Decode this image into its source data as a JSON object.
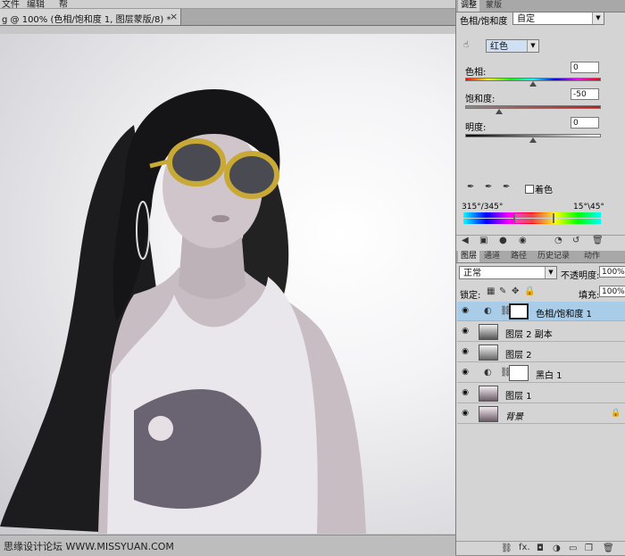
{
  "menu": {
    "items": [
      "文件",
      "编辑",
      "帮"
    ]
  },
  "document": {
    "tab_label": "g @ 100% (色相/饱和度 1, 图层蒙版/8) *",
    "close_glyph": "×"
  },
  "status": {
    "watermark": "思缘设计论坛 WWW.MISSYUAN.COM"
  },
  "adjust_panel": {
    "tabs": [
      "调整",
      "蒙版"
    ],
    "title": "色相/饱和度",
    "preset": "自定",
    "channel": "红色",
    "hue": {
      "label": "色相:",
      "value": "0"
    },
    "saturation": {
      "label": "饱和度:",
      "value": "-50"
    },
    "lightness": {
      "label": "明度:",
      "value": "0"
    },
    "colorize_label": "着色",
    "range_left": "315°/345°",
    "range_right": "15°\\45°"
  },
  "layers_panel": {
    "tabs": [
      "图层",
      "通道",
      "路径",
      "历史记录",
      "动作"
    ],
    "blend_mode": "正常",
    "opacity_label": "不透明度:",
    "opacity_value": "100%",
    "lock_label": "锁定:",
    "fill_label": "填充:",
    "fill_value": "100%",
    "layers": [
      {
        "name": "色相/饱和度 1"
      },
      {
        "name": "图层 2 副本"
      },
      {
        "name": "图层 2"
      },
      {
        "name": "黑白 1"
      },
      {
        "name": "图层 1"
      },
      {
        "name": "背景"
      }
    ],
    "footer_fx": "fx."
  },
  "colors": {
    "selected_layer": "#a9cde8",
    "lens_frame": "#c9a935"
  }
}
